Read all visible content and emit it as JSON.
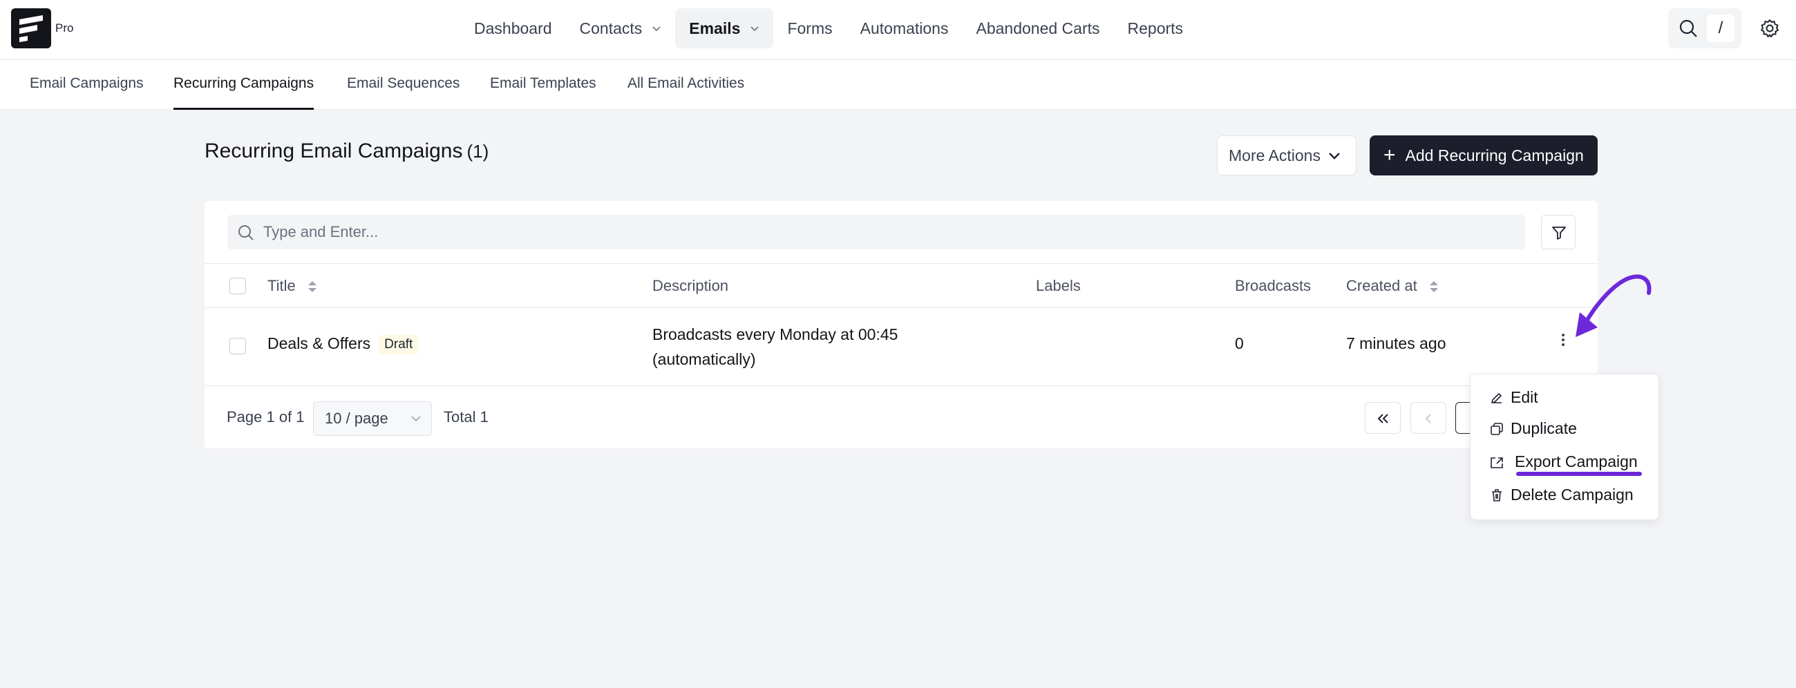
{
  "brand": {
    "tier": "Pro"
  },
  "nav": {
    "items": [
      {
        "label": "Dashboard"
      },
      {
        "label": "Contacts"
      },
      {
        "label": "Emails"
      },
      {
        "label": "Forms"
      },
      {
        "label": "Automations"
      },
      {
        "label": "Abandoned Carts"
      },
      {
        "label": "Reports"
      }
    ],
    "search_shortcut": "/"
  },
  "subtabs": [
    {
      "label": "Email Campaigns"
    },
    {
      "label": "Recurring Campaigns"
    },
    {
      "label": "Email Sequences"
    },
    {
      "label": "Email Templates"
    },
    {
      "label": "All Email Activities"
    }
  ],
  "page": {
    "title": "Recurring Email Campaigns",
    "count": "(1)",
    "more_actions": "More Actions",
    "add_button": "Add Recurring Campaign"
  },
  "search": {
    "placeholder": "Type and Enter..."
  },
  "table": {
    "columns": [
      "Title",
      "Description",
      "Labels",
      "Broadcasts",
      "Created at"
    ],
    "rows": [
      {
        "title": "Deals & Offers",
        "status": "Draft",
        "description_line1": "Broadcasts every Monday at 00:45",
        "description_line2": "(automatically)",
        "labels": "",
        "broadcasts": "0",
        "created_at": "7 minutes ago"
      }
    ]
  },
  "pagination": {
    "page_info": "Page 1 of 1",
    "per_page": "10 / page",
    "total": "Total 1"
  },
  "row_menu": {
    "items": [
      {
        "label": "Edit",
        "icon": "pencil-icon"
      },
      {
        "label": "Duplicate",
        "icon": "copy-icon"
      },
      {
        "label": "Export Campaign",
        "icon": "export-icon"
      },
      {
        "label": "Delete Campaign",
        "icon": "trash-icon"
      }
    ]
  },
  "colors": {
    "accent_dark": "#1c1f2b",
    "annotation": "#6d28d9",
    "badge_bg": "#fef9e6"
  }
}
